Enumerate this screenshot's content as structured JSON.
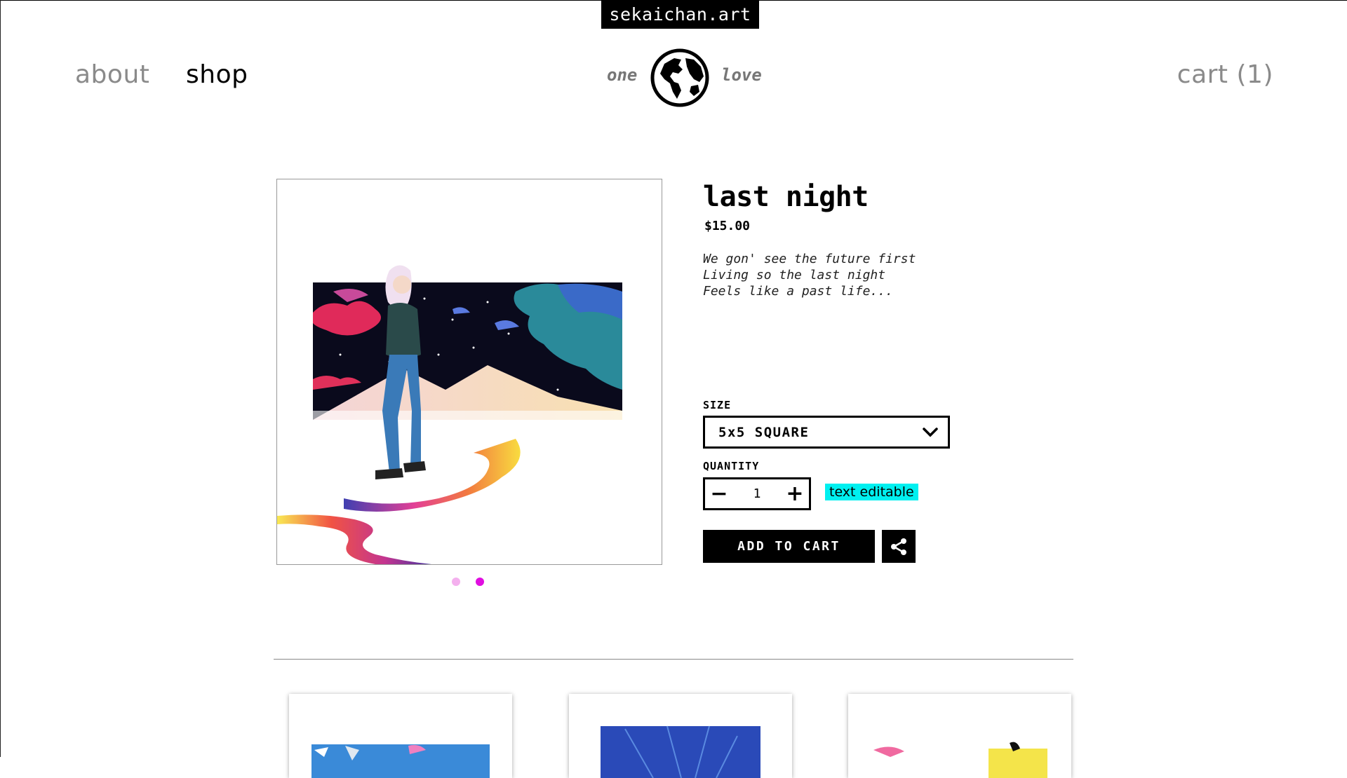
{
  "site": {
    "title": "sekaichan.art"
  },
  "nav": {
    "about": "about",
    "shop": "shop",
    "cart": "cart (1)",
    "tagline_left": "one",
    "tagline_right": "love"
  },
  "product": {
    "title": "last night",
    "price": "$15.00",
    "description": [
      "We gon' see the future first",
      "Living so the last night",
      "Feels like a past life..."
    ],
    "size_label": "SIZE",
    "size_value": "5x5 SQUARE",
    "quantity_label": "QUANTITY",
    "quantity_value": "1",
    "minus_symbol": "−",
    "plus_symbol": "+",
    "editable_note": "text editable",
    "add_to_cart_label": "ADD TO CART",
    "image_dots": {
      "count": 2,
      "active": 2
    }
  },
  "colors": {
    "accent_cyan": "#00f0f0",
    "dot_inactive": "#f4b0ee",
    "dot_active": "#e00ee0",
    "nav_inactive": "#8a8a8a"
  },
  "icons": {
    "logo": "globe-icon",
    "share": "share-icon",
    "dropdown": "chevron-down-icon"
  }
}
